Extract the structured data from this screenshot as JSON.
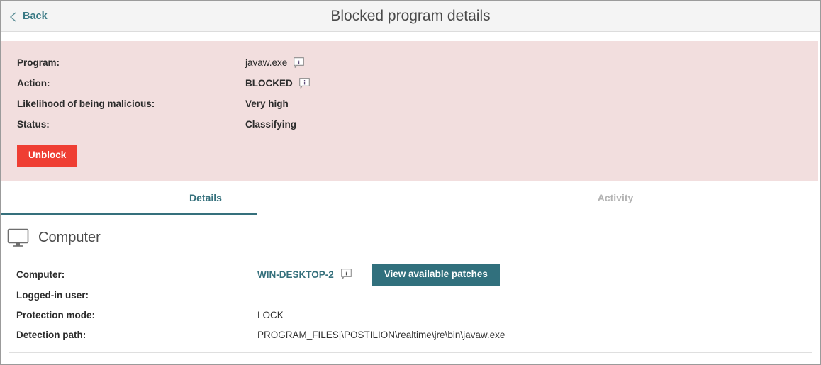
{
  "header": {
    "back_label": "Back",
    "title": "Blocked program details",
    "back_icon": "chevron-left-icon"
  },
  "alert": {
    "rows": [
      {
        "label": "Program:",
        "value": "javaw.exe",
        "bold": false,
        "info": true
      },
      {
        "label": "Action:",
        "value": "BLOCKED",
        "bold": true,
        "info": true
      },
      {
        "label": "Likelihood of being malicious:",
        "value": "Very high",
        "bold": true,
        "info": false
      },
      {
        "label": "Status:",
        "value": "Classifying",
        "bold": true,
        "info": false
      }
    ],
    "unblock_label": "Unblock",
    "background_color": "#f2dede",
    "unblock_color": "#ef3e33"
  },
  "tabs": [
    {
      "label": "Details",
      "active": true
    },
    {
      "label": "Activity",
      "active": false
    }
  ],
  "computer": {
    "section_title": "Computer",
    "section_icon": "monitor-icon",
    "rows": [
      {
        "label": "Computer:",
        "value": "WIN-DESKTOP-2"
      },
      {
        "label": "Logged-in user:",
        "value": ""
      },
      {
        "label": "Protection mode:",
        "value": "LOCK"
      },
      {
        "label": "Detection path:",
        "value": "PROGRAM_FILES|\\POSTILION\\realtime\\jre\\bin\\javaw.exe"
      }
    ],
    "patches_button": "View available patches",
    "link_color": "#35707c",
    "button_color": "#31707d"
  },
  "icons": {
    "info": "info-bubble-icon"
  }
}
